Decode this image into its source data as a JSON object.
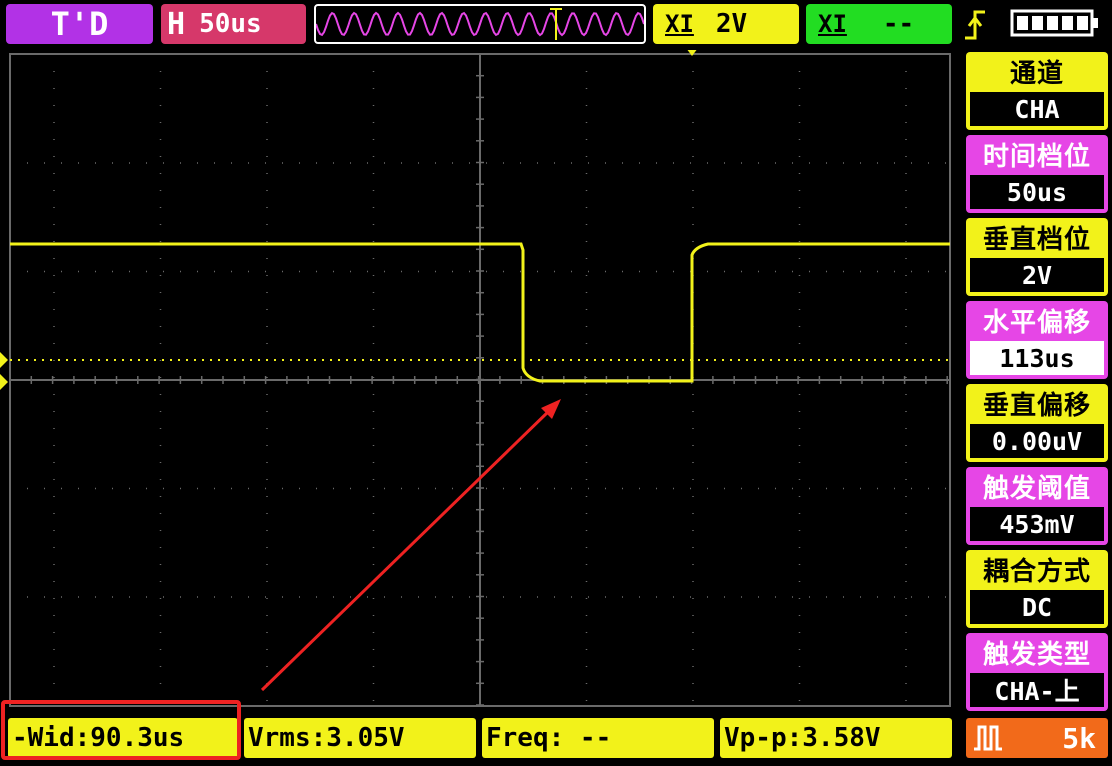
{
  "top": {
    "mode": "T'D",
    "timebase_letter": "H",
    "timebase_value": "50us",
    "ch1_coupling": "XI",
    "ch1_scale": "2V",
    "ch2_coupling": "XI",
    "ch2_scale": "--"
  },
  "menu": [
    {
      "label": "通道",
      "value": "CHA",
      "color": "yellow",
      "selected": false
    },
    {
      "label": "时间档位",
      "value": "50us",
      "color": "pink",
      "selected": false
    },
    {
      "label": "垂直档位",
      "value": "2V",
      "color": "yellow",
      "selected": false
    },
    {
      "label": "水平偏移",
      "value": "113us",
      "color": "pink",
      "selected": true
    },
    {
      "label": "垂直偏移",
      "value": "0.00uV",
      "color": "yellow",
      "selected": false
    },
    {
      "label": "触发阈值",
      "value": "453mV",
      "color": "pink",
      "selected": false
    },
    {
      "label": "耦合方式",
      "value": "DC",
      "color": "yellow",
      "selected": false
    },
    {
      "label": "触发类型",
      "value": "CHA-上",
      "color": "pink",
      "selected": false
    }
  ],
  "measurements": {
    "wid": "-Wid:90.3us",
    "vrms": "Vrms:3.05V",
    "freq": "Freq: --",
    "vpp": "Vp-p:3.58V"
  },
  "acquisition": {
    "depth": "5k"
  },
  "colors": {
    "trace": "#f2f21a",
    "annotation": "#ee2222",
    "grid": "#6a6a6a"
  }
}
